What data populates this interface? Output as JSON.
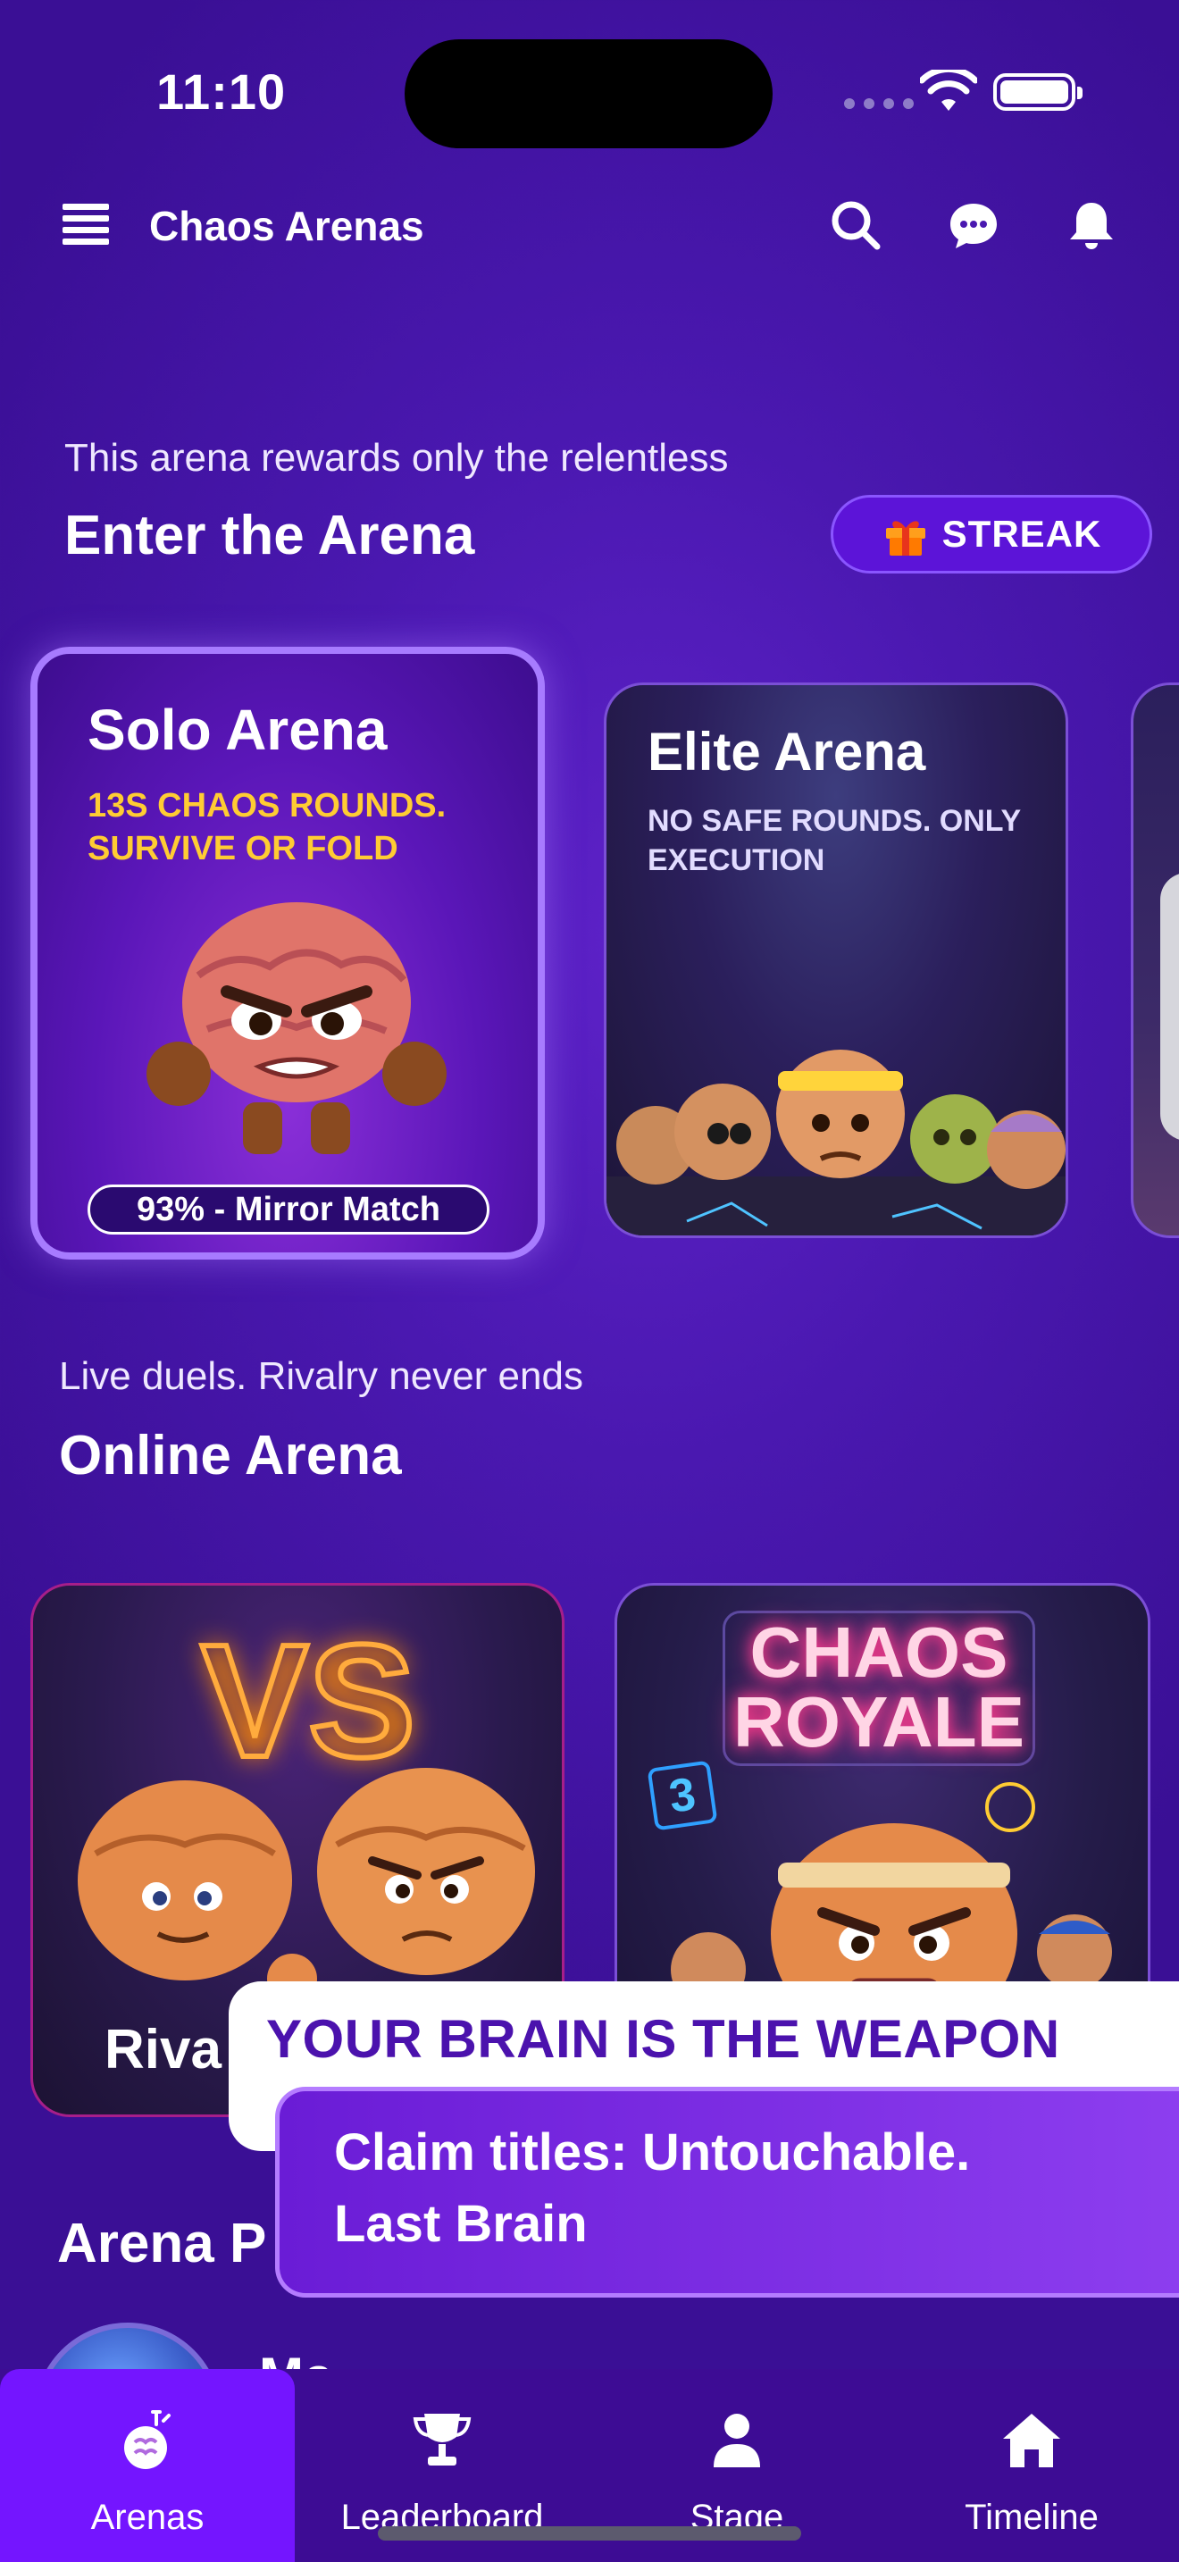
{
  "status_bar": {
    "time": "11:10"
  },
  "header": {
    "title": "Chaos Arenas"
  },
  "enter_section": {
    "kicker": "This arena rewards only the relentless",
    "title": "Enter the Arena",
    "streak_label": "STREAK"
  },
  "arena_cards": [
    {
      "title": "Solo Arena",
      "subtitle": "13S CHAOS ROUNDS. SURVIVE OR FOLD",
      "badge": "93% - Mirror Match"
    },
    {
      "title": "Elite Arena",
      "subtitle": "NO SAFE ROUNDS. ONLY EXECUTION"
    }
  ],
  "online_section": {
    "kicker": "Live duels. Rivalry never ends",
    "title": "Online Arena",
    "cards": [
      {
        "neon": "VS",
        "label": "Riva"
      },
      {
        "neon_line1": "CHAOS",
        "neon_line2": "ROYALE",
        "badge": "3"
      }
    ]
  },
  "partial_section": {
    "title": "Arena P"
  },
  "partial_row": {
    "label": "Ma"
  },
  "banner": {
    "headline": "YOUR BRAIN IS THE WEAPON",
    "line1": "Claim titles: Untouchable.",
    "line2": "Last Brain"
  },
  "bottom_nav": [
    {
      "label": "Arenas",
      "active": true
    },
    {
      "label": "Leaderboard",
      "active": false
    },
    {
      "label": "Stage",
      "active": false
    },
    {
      "label": "Timeline",
      "active": false
    }
  ],
  "colors": {
    "background": "#4a18b0",
    "accent_yellow": "#ffcc33",
    "nav_active": "#7415ff",
    "banner_text": "#4b12ad"
  }
}
